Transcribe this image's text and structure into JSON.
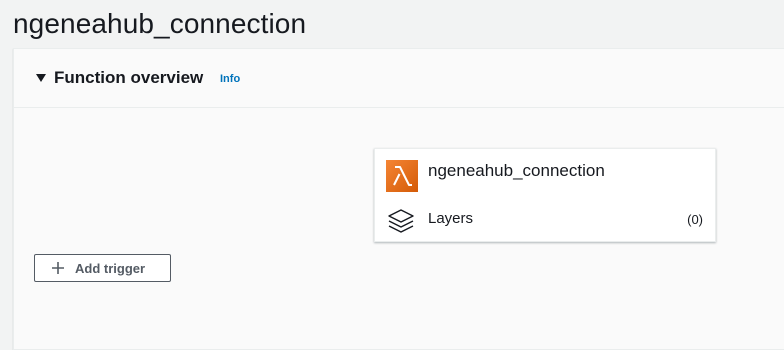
{
  "page": {
    "title": "ngeneahub_connection"
  },
  "function_overview": {
    "title": "Function overview",
    "info_link": "Info",
    "function_name": "ngeneahub_connection",
    "function_icon": "lambda-icon",
    "layers": {
      "label": "Layers",
      "count": "(0)",
      "icon": "layers-icon"
    },
    "add_trigger": {
      "label": "Add trigger",
      "icon": "plus-icon"
    }
  },
  "colors": {
    "accent_link": "#0073bb",
    "lambda_orange": "#e46e1a",
    "text": "#16191f",
    "button_border": "#545b64"
  }
}
